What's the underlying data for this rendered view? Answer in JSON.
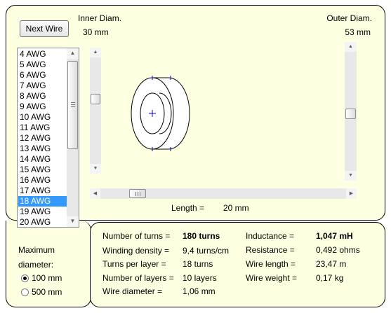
{
  "toolbar": {
    "next_wire_label": "Next Wire"
  },
  "inner_diameter": {
    "label": "Inner Diam.",
    "value": "30 mm"
  },
  "outer_diameter": {
    "label": "Outer Diam.",
    "value": "53 mm"
  },
  "length": {
    "label": "Length =",
    "value": "20 mm"
  },
  "wire_list": {
    "items": [
      "4 AWG",
      "5 AWG",
      "6 AWG",
      "7 AWG",
      "8 AWG",
      "9 AWG",
      "10 AWG",
      "11 AWG",
      "12 AWG",
      "13 AWG",
      "14 AWG",
      "15 AWG",
      "16 AWG",
      "17 AWG",
      "18 AWG",
      "19 AWG",
      "20 AWG"
    ],
    "selected": "18 AWG"
  },
  "max_diameter": {
    "label_line1": "Maximum",
    "label_line2": "diameter:",
    "options": [
      "100 mm",
      "500 mm"
    ],
    "selected": "100 mm"
  },
  "results": {
    "turns_label": "Number of turns =",
    "turns_value": "180 turns",
    "density_label": "Winding density =",
    "density_value": "9,4 turns/cm",
    "per_layer_label": "Turns per layer =",
    "per_layer_value": "18 turns",
    "layers_label": "Number of layers =",
    "layers_value": "10 layers",
    "wire_diam_label": "Wire diameter =",
    "wire_diam_value": "1,06 mm",
    "inductance_label": "Inductance =",
    "inductance_value": "1,047 mH",
    "resistance_label": "Resistance =",
    "resistance_value": "0,492 ohms",
    "wire_length_label": "Wire length =",
    "wire_length_value": "23,47 m",
    "wire_weight_label": "Wire weight =",
    "wire_weight_value": "0,17 kg"
  },
  "colors": {
    "panel_background": "#ffffe1",
    "selection": "#3399ff",
    "guide_marks": "#0000cc"
  },
  "icons": [
    "scroll-up-arrow-icon",
    "scroll-down-arrow-icon",
    "scroll-left-arrow-icon",
    "scroll-right-arrow-icon",
    "coil-crosshair-icon"
  ]
}
